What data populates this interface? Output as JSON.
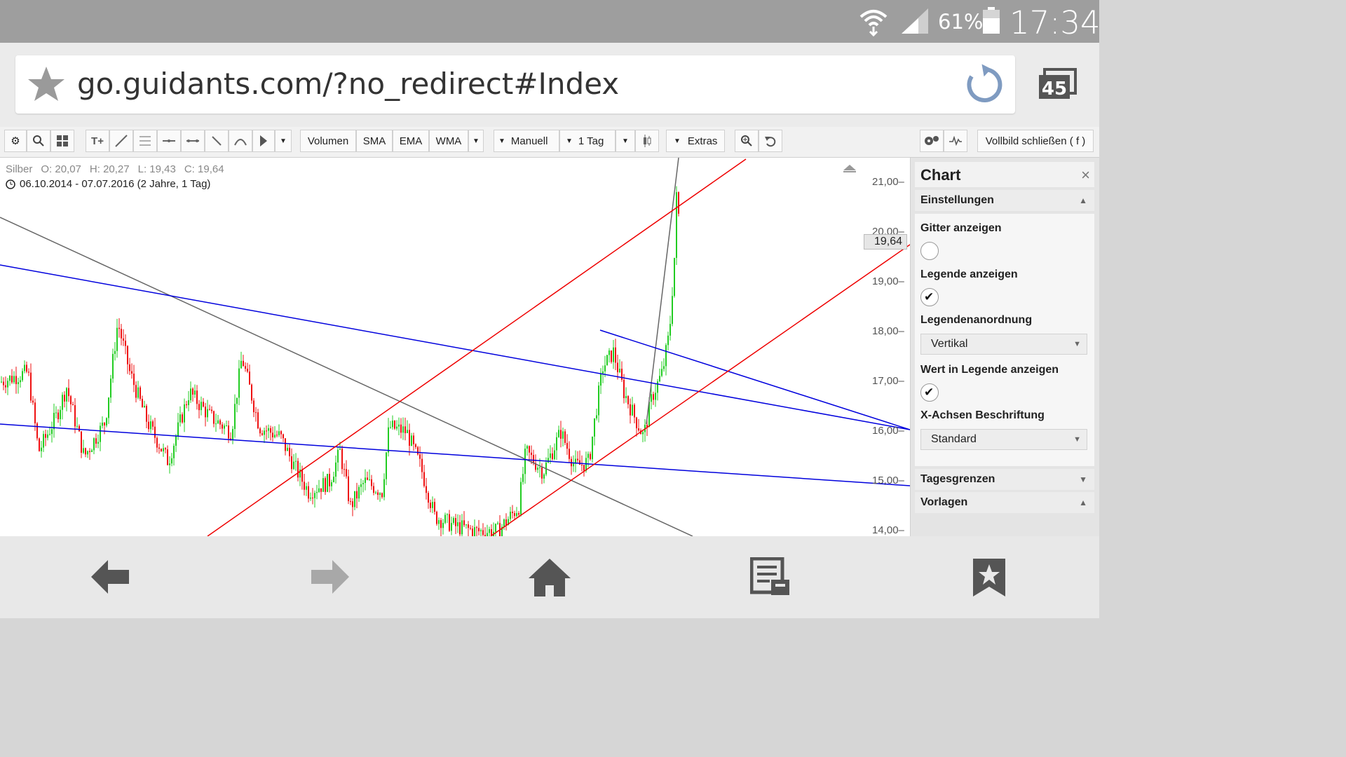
{
  "status": {
    "battery_pct": "61%",
    "time": "17:34"
  },
  "browser": {
    "url": "go.guidants.com/?no_redirect#Index",
    "tab_count": "45"
  },
  "toolbar": {
    "volume": "Volumen",
    "sma": "SMA",
    "ema": "EMA",
    "wma": "WMA",
    "mode": "Manuell",
    "period": "1 Tag",
    "extras": "Extras",
    "fullscreen": "Vollbild schließen ( f )"
  },
  "legend": {
    "instrument": "Silber",
    "open": "O: 20,07",
    "high": "H: 20,27",
    "low": "L: 19,43",
    "close": "C: 19,64",
    "range": "06.10.2014 - 07.07.2016 (2 Jahre, 1 Tag)"
  },
  "chart_data": {
    "type": "line",
    "title": "Silber",
    "y_ticks": [
      "21,00",
      "20,00",
      "19,00",
      "18,00",
      "17,00",
      "16,00",
      "15,00",
      "14,00"
    ],
    "current_price": "19,64",
    "ylim": [
      14,
      21.2
    ],
    "x_start": "06.10.2014",
    "x_end": "07.07.2016",
    "colors": {
      "up": "#22cc22",
      "down": "#ee1111",
      "channel_up": "#ee0000",
      "channel_down": "#0000dd",
      "trend": "#666666"
    }
  },
  "panel": {
    "title": "Chart",
    "close": "×",
    "settings": "Einstellungen",
    "grid": "Gitter anzeigen",
    "legend": "Legende anzeigen",
    "legend_layout": "Legendenanordnung",
    "legend_layout_value": "Vertikal",
    "value_in_legend": "Wert in Legende anzeigen",
    "x_axis_label": "X-Achsen Beschriftung",
    "x_axis_value": "Standard",
    "day_limits": "Tagesgrenzen",
    "templates": "Vorlagen"
  }
}
